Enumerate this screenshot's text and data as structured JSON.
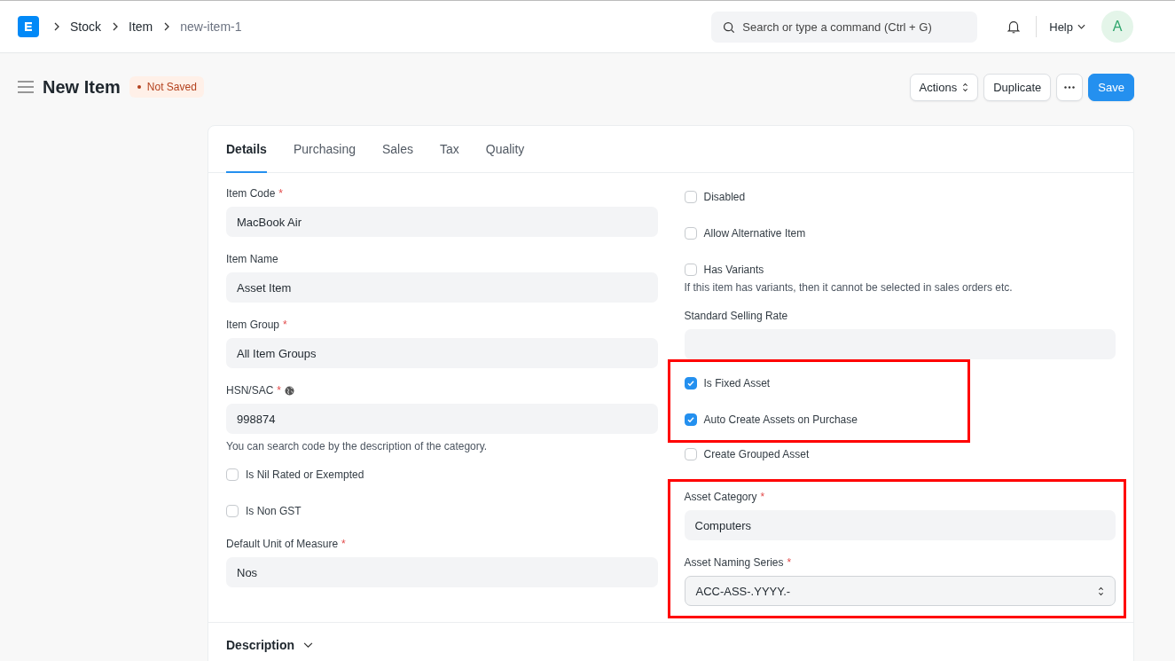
{
  "navbar": {
    "breadcrumbs": [
      {
        "label": "Stock",
        "current": false
      },
      {
        "label": "Item",
        "current": false
      },
      {
        "label": "new-item-1",
        "current": true
      }
    ],
    "search": {
      "placeholder": "Search or type a command (Ctrl + G)"
    },
    "help": "Help",
    "avatar": "A"
  },
  "page": {
    "title": "New Item",
    "status": "Not Saved",
    "buttons": [
      {
        "kind": "dropdown",
        "label": "Actions"
      },
      {
        "kind": "default",
        "label": "Duplicate"
      },
      {
        "kind": "more"
      },
      {
        "kind": "primary",
        "label": "Save"
      }
    ]
  },
  "tabs": [
    {
      "label": "Details",
      "selected": true
    },
    {
      "label": "Purchasing",
      "selected": false
    },
    {
      "label": "Sales",
      "selected": false
    },
    {
      "label": "Tax",
      "selected": false
    },
    {
      "label": "Quality",
      "selected": false
    }
  ],
  "left_column": [
    {
      "kind": "field",
      "label": "Item Code",
      "required_mark": "*",
      "value": "MacBook Air"
    },
    {
      "kind": "field",
      "label": "Item Name",
      "value": "Asset Item"
    },
    {
      "kind": "field",
      "label": "Item Group",
      "required_mark": "*",
      "value": "All Item Groups"
    },
    {
      "kind": "field",
      "label": "HSN/SAC",
      "required_mark": "*",
      "globe_icon": true,
      "value": "998874",
      "description": "You can search code by the description of the category."
    },
    {
      "kind": "checkbox",
      "label": "Is Nil Rated or Exempted",
      "checked": false
    },
    {
      "kind": "checkbox",
      "label": "Is Non GST",
      "checked": false
    },
    {
      "kind": "field",
      "label": "Default Unit of Measure",
      "required_mark": "*",
      "value": "Nos"
    }
  ],
  "right_column": [
    {
      "highlighted": false,
      "items": [
        {
          "kind": "checkbox",
          "label": "Disabled",
          "checked": false
        },
        {
          "kind": "checkbox",
          "label": "Allow Alternative Item",
          "checked": false
        },
        {
          "kind": "checkbox",
          "label": "Has Variants",
          "checked": false,
          "description": "If this item has variants, then it cannot be selected in sales orders etc."
        },
        {
          "kind": "field",
          "label": "Standard Selling Rate"
        }
      ]
    },
    {
      "highlighted": true,
      "items": [
        {
          "kind": "checkbox",
          "label": "Is Fixed Asset",
          "checked": true
        },
        {
          "kind": "checkbox",
          "label": "Auto Create Assets on Purchase",
          "checked": true
        }
      ]
    },
    {
      "highlighted": false,
      "items": [
        {
          "kind": "checkbox",
          "label": "Create Grouped Asset",
          "checked": false
        }
      ]
    },
    {
      "highlighted": true,
      "items": [
        {
          "kind": "field",
          "label": "Asset Category",
          "required_mark": "*",
          "value": "Computers"
        },
        {
          "kind": "select",
          "label": "Asset Naming Series",
          "required_mark": "*",
          "value": "ACC-ASS-.YYYY.-"
        }
      ]
    }
  ],
  "section": {
    "title": "Description",
    "expanded": false
  }
}
